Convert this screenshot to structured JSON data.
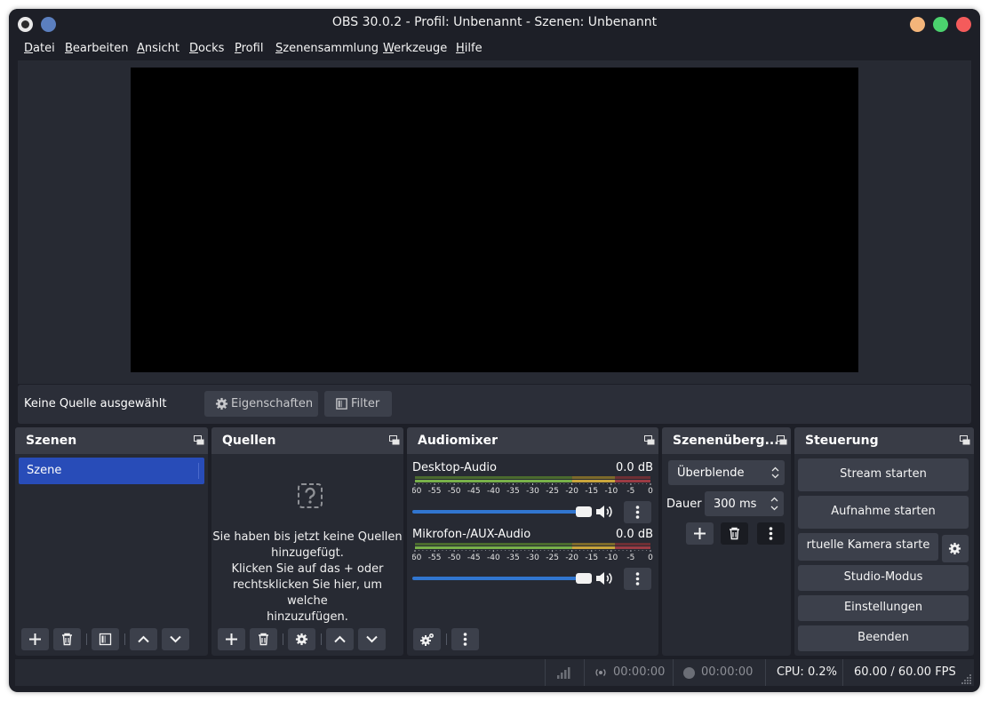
{
  "window": {
    "title": "OBS 30.0.2 - Profil: Unbenannt - Szenen: Unbenannt"
  },
  "menu": [
    {
      "label": "Datei",
      "accel": "D",
      "rest": "atei"
    },
    {
      "label": "Bearbeiten",
      "accel": "B",
      "rest": "earbeiten"
    },
    {
      "label": "Ansicht",
      "accel": "A",
      "rest": "nsicht"
    },
    {
      "label": "Docks",
      "accel": "D",
      "rest": "ocks"
    },
    {
      "label": "Profil",
      "accel": "P",
      "rest": "rofil"
    },
    {
      "label": "Szenensammlung",
      "accel": "S",
      "rest": "zenensammlung"
    },
    {
      "label": "Werkzeuge",
      "accel": "W",
      "rest": "erkzeuge"
    },
    {
      "label": "Hilfe",
      "accel": "H",
      "rest": "ilfe"
    }
  ],
  "source_bar": {
    "status": "Keine Quelle ausgewählt",
    "properties_label": "Eigenschaften",
    "filter_label": "Filter"
  },
  "docks": {
    "scenes": {
      "title": "Szenen",
      "items": [
        "Szene"
      ]
    },
    "sources": {
      "title": "Quellen",
      "empty_line1": "Sie haben bis jetzt keine Quellen",
      "empty_line2": "hinzugefügt.",
      "empty_line3": "Klicken Sie auf das + oder",
      "empty_line4": "rechtsklicken Sie hier, um welche",
      "empty_line5": "hinzuzufügen."
    },
    "mixer": {
      "title": "Audiomixer",
      "channels": [
        {
          "name": "Desktop-Audio",
          "db": "0.0 dB",
          "volume": 1.0
        },
        {
          "name": "Mikrofon-/AUX-Audio",
          "db": "0.0 dB",
          "volume": 1.0
        }
      ],
      "scale": [
        "-60",
        "-55",
        "-50",
        "-45",
        "-40",
        "-35",
        "-30",
        "-25",
        "-20",
        "-15",
        "-10",
        "-5",
        "0"
      ]
    },
    "transitions": {
      "title": "Szenenüberg...",
      "selected": "Überblende",
      "duration_label": "Dauer",
      "duration_value": "300 ms"
    },
    "controls": {
      "title": "Steuerung",
      "stream": "Stream starten",
      "record": "Aufnahme starten",
      "virtual_cam": "rtuelle Kamera starte",
      "studio": "Studio-Modus",
      "settings": "Einstellungen",
      "quit": "Beenden"
    }
  },
  "status": {
    "stream_time": "00:00:00",
    "record_time": "00:00:00",
    "cpu": "CPU: 0.2%",
    "fps": "60.00 / 60.00 FPS"
  },
  "colors": {
    "accent": "#284cb8",
    "window_bg": "#1d1f27",
    "panel_bg": "#272a33",
    "button_bg": "#3c404b",
    "slider": "#3176d0"
  }
}
